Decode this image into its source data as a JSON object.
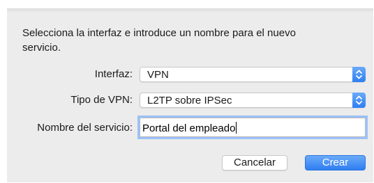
{
  "dialog": {
    "intro_text": "Selecciona la interfaz e introduce un nombre para el nuevo servicio.",
    "interface": {
      "label": "Interfaz:",
      "selected": "VPN"
    },
    "vpn_type": {
      "label": "Tipo de VPN:",
      "selected": "L2TP sobre IPSec"
    },
    "service_name": {
      "label": "Nombre del servicio:",
      "value": "Portal del empleado"
    },
    "buttons": {
      "cancel_label": "Cancelar",
      "create_label": "Crear"
    }
  },
  "colors": {
    "accent": "#3b86f5",
    "focus_ring": "#9cc2f7",
    "sheet_background": "#ececec"
  },
  "icons": {
    "popup_stepper": "up-down-chevron-icon"
  }
}
